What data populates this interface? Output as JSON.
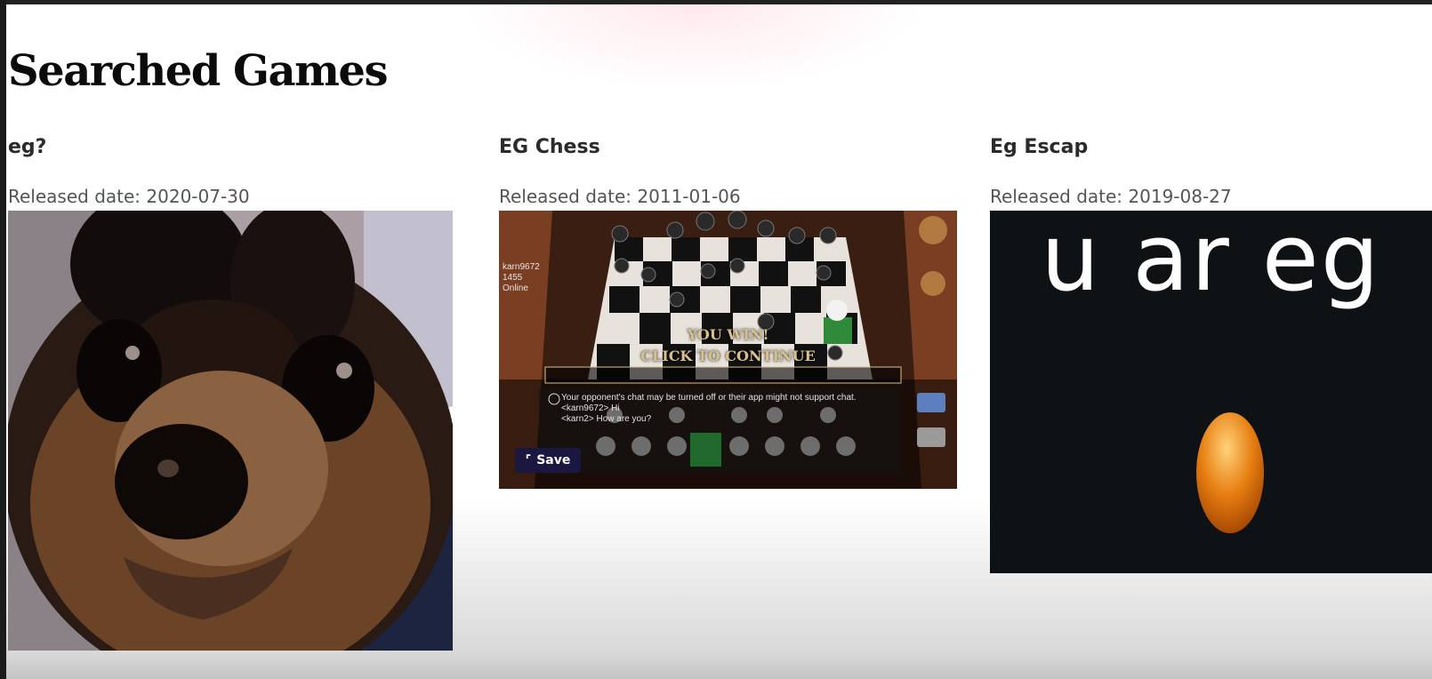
{
  "page": {
    "title": "Searched Games"
  },
  "games": [
    {
      "title": "eg?",
      "release_label": "Released date: 2020-07-30",
      "image": "dog-photo"
    },
    {
      "title": "EG Chess",
      "release_label": "Released date: 2011-01-06",
      "image": "chess-board-screenshot",
      "overlay": {
        "win_text": "YOU WIN!",
        "continue_text": "CLICK TO CONTINUE",
        "player_name": "karn9672",
        "player_rating": "1455",
        "player_status": "Online",
        "chat_notice": "Your opponent's chat may be turned off or their app might not support chat.",
        "chat_lines": [
          "<karn9672> Hi",
          "<karn2> How are you?"
        ],
        "save_label": "Save"
      }
    },
    {
      "title": "Eg Escap",
      "release_label": "Released date: 2019-08-27",
      "image": "egg-on-black",
      "caption": "u ar eg"
    }
  ]
}
